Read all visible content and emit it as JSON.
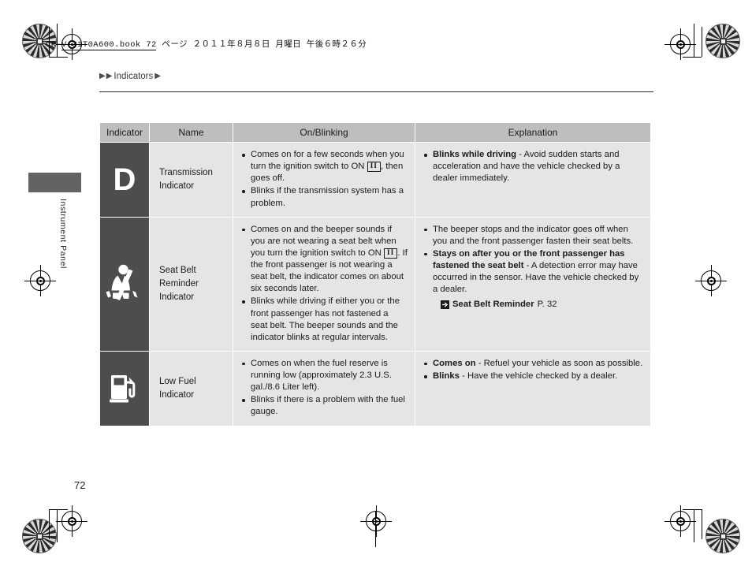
{
  "print_header": "CR-V-31T0A600.book   72 ページ   ２０１１年８月８日   月曜日   午後６時２６分",
  "breadcrumb": {
    "arrow1": "▶",
    "arrow2": "▶",
    "text": "Indicators",
    "arrow3": "▶"
  },
  "side_tab": {
    "label": "Instrument Panel"
  },
  "page_number": "72",
  "table": {
    "headers": [
      "Indicator",
      "Name",
      "On/Blinking",
      "Explanation"
    ],
    "rows": [
      {
        "icon_name": "transmission-d-icon",
        "icon_glyph": "D",
        "name": "Transmission Indicator",
        "name_line1": "Transmission",
        "name_line2": "Indicator",
        "onblinking": [
          "Comes on for a few seconds when you turn the ignition switch to ON [II], then goes off.",
          "Blinks if the transmission system has a problem."
        ],
        "explanation": [
          "Blinks while driving - Avoid sudden starts and acceleration and have the vehicle checked by a dealer immediately."
        ]
      },
      {
        "icon_name": "seat-belt-reminder-icon",
        "name": "Seat Belt Reminder Indicator",
        "name_line1": "Seat Belt",
        "name_line2": "Reminder",
        "name_line3": "Indicator",
        "onblinking": [
          "Comes on and the beeper sounds if you are not wearing a seat belt when you turn the ignition switch to ON [II]. If the front passenger is not wearing a seat belt, the indicator comes on about six seconds later.",
          "Blinks while driving if either you or the front passenger has not fastened a seat belt. The beeper sounds and the indicator blinks at regular intervals."
        ],
        "explanation": [
          "The beeper stops and the indicator goes off when you and the front passenger fasten their seat belts.",
          "Stays on after you or the front passenger has fastened the seat belt - A detection error may have occurred in the sensor. Have the vehicle checked by a dealer."
        ],
        "xref": {
          "icon": "xref-arrow-icon",
          "title": "Seat Belt Reminder",
          "page": "P. 32"
        }
      },
      {
        "icon_name": "low-fuel-icon",
        "name": "Low Fuel Indicator",
        "name_line1": "Low Fuel",
        "name_line2": "Indicator",
        "onblinking": [
          "Comes on when the fuel reserve is running low (approximately 2.3 U.S. gal./8.6 Liter left).",
          "Blinks if there is a problem with the fuel gauge."
        ],
        "explanation": [
          "Comes on - Refuel your vehicle as soon as possible.",
          "Blinks - Have the vehicle checked by a dealer."
        ]
      }
    ]
  },
  "text_fragments": {
    "r1_on_b1_a": "Comes on for a few seconds when you turn the ignition switch to ON ",
    "r1_on_b1_key": "II",
    "r1_on_b1_b": ", then goes off.",
    "r1_on_b2": "Blinks if the transmission system has a problem.",
    "r1_ex_bold": "Blinks while driving",
    "r1_ex_rest": " - Avoid sudden starts and acceleration and have the vehicle checked by a dealer immediately.",
    "r2_on_b1_a": "Comes on and the beeper sounds if you are not wearing a seat belt when you turn the ignition switch to ON ",
    "r2_on_b1_key": "II",
    "r2_on_b1_b": ". If the front passenger is not wearing a seat belt, the indicator comes on about six seconds later.",
    "r2_on_b2": "Blinks while driving if either you or the front passenger has not fastened a seat belt. The beeper sounds and the indicator blinks at regular intervals.",
    "r2_ex_b1": "The beeper stops and the indicator goes off when you and the front passenger fasten their seat belts.",
    "r2_ex_b2_bold": "Stays on after you or the front passenger has fastened the seat belt",
    "r2_ex_b2_rest": " - A detection error may have occurred in the sensor. Have the vehicle checked by a dealer.",
    "r2_xref_title": "Seat Belt Reminder",
    "r2_xref_page": "P. 32",
    "r3_on_b1": "Comes on when the fuel reserve is running low (approximately 2.3 U.S. gal./8.6 Liter left).",
    "r3_on_b2": "Blinks if there is a problem with the fuel gauge.",
    "r3_ex_b1_bold": "Comes on",
    "r3_ex_b1_rest": " - Refuel your vehicle as soon as possible.",
    "r3_ex_b2_bold": "Blinks",
    "r3_ex_b2_rest": " - Have the vehicle checked by a dealer."
  },
  "colors": {
    "header_bg": "#bebebe",
    "cell_bg": "#e5e5e5",
    "icon_bg": "#4d4d4d",
    "tab_bg": "#636363",
    "text": "#1b1b1b"
  }
}
